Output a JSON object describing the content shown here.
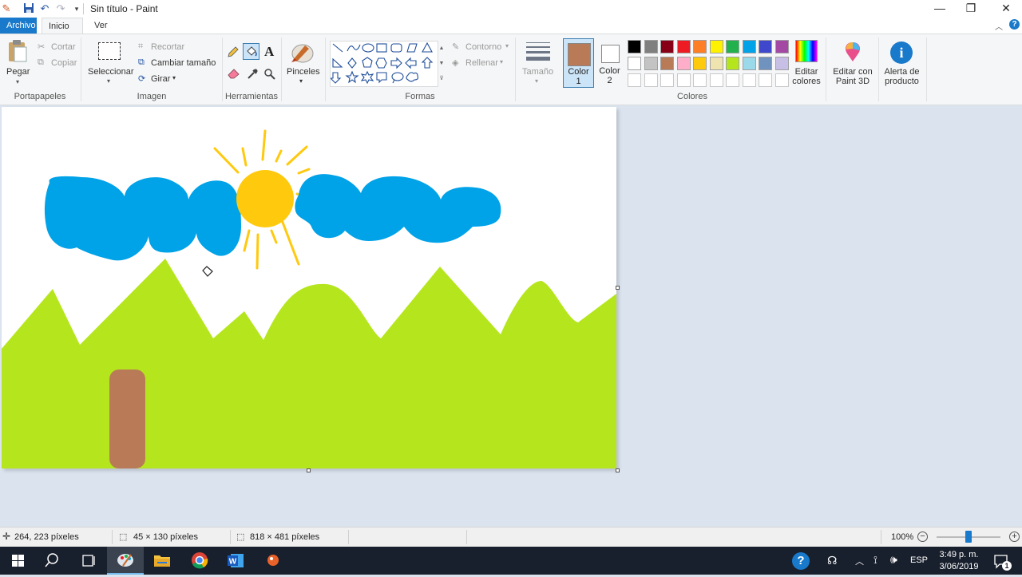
{
  "window": {
    "title": "Sin título - Paint"
  },
  "tabs": [
    "Archivo",
    "Inicio",
    "Ver"
  ],
  "clipboard": {
    "paste": "Pegar",
    "cut": "Cortar",
    "copy": "Copiar",
    "label": "Portapapeles"
  },
  "image": {
    "select": "Seleccionar",
    "crop": "Recortar",
    "resize": "Cambiar tamaño",
    "rotate": "Girar",
    "label": "Imagen"
  },
  "tools": {
    "label": "Herramientas",
    "text_tool": "A"
  },
  "brushes": {
    "label": "Pinceles"
  },
  "shapes": {
    "outline": "Contorno",
    "fill": "Rellenar",
    "label": "Formas"
  },
  "size": {
    "label": "Tamaño"
  },
  "colors": {
    "color1_label": "Color",
    "color1_num": "1",
    "color2_label": "Color",
    "color2_num": "2",
    "label": "Colores",
    "edit_line1": "Editar",
    "edit_line2": "colores",
    "color1_value": "#b97a57",
    "color2_value": "#ffffff",
    "palette_row1": [
      "#000000",
      "#7f7f7f",
      "#880015",
      "#ed1c24",
      "#ff7f27",
      "#fff200",
      "#22b14c",
      "#00a2e8",
      "#3f48cc",
      "#a349a4"
    ],
    "palette_row2": [
      "#ffffff",
      "#c3c3c3",
      "#b97a57",
      "#ffaec9",
      "#ffc90e",
      "#efe4b0",
      "#b5e61d",
      "#99d9ea",
      "#7092be",
      "#c8bfe7"
    ],
    "custom_count": 10
  },
  "paint3d": {
    "line1": "Editar con",
    "line2": "Paint 3D"
  },
  "alert": {
    "line1": "Alerta de",
    "line2": "producto"
  },
  "drawing": {
    "sky": "#ffffff",
    "clouds": "#00a2e8",
    "sun": "#ffc90e",
    "grass": "#b5e61d",
    "trunk": "#b97a57"
  },
  "status": {
    "cursor": "264, 223 píxeles",
    "selection": "45 × 130 píxeles",
    "canvas_size": "818 × 481 píxeles",
    "zoom": "100%",
    "zoom_fraction": 0.5
  },
  "taskbar": {
    "language": "ESP",
    "time": "3:49 p. m.",
    "date": "3/06/2019",
    "notifications": "1"
  }
}
